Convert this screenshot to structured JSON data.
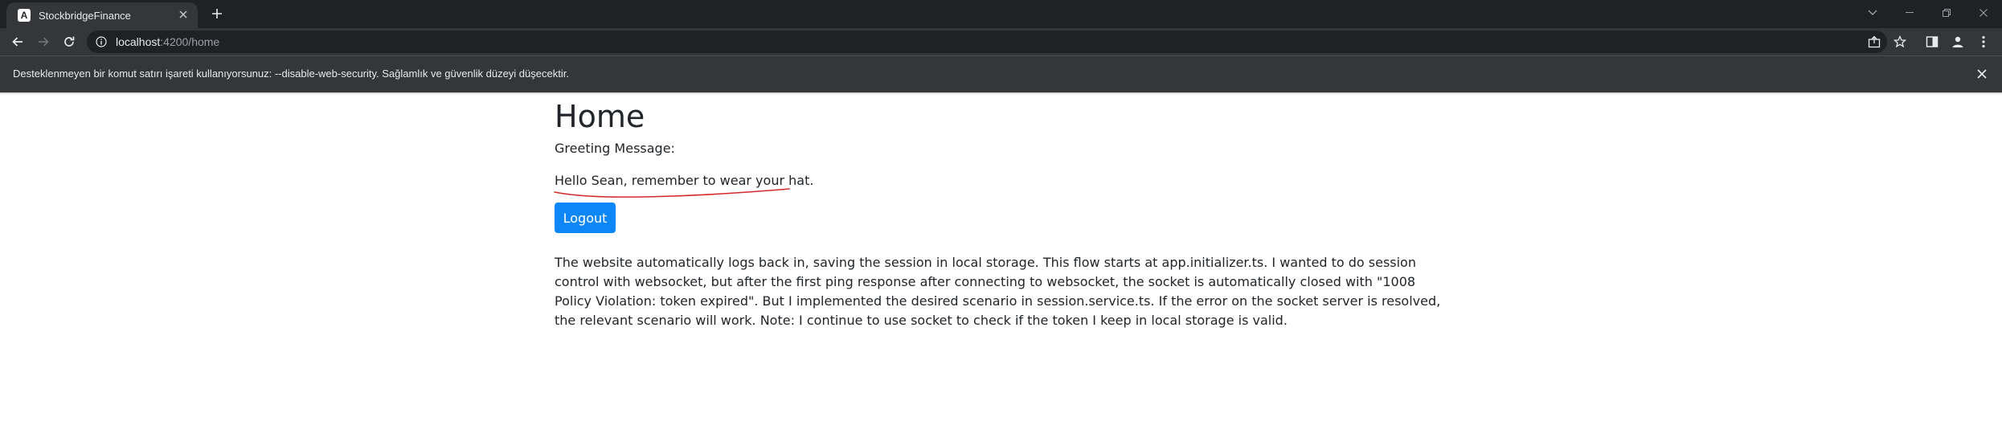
{
  "browser": {
    "tab_title": "StockbridgeFinance",
    "tab_favicon_letter": "A",
    "url_host": "localhost",
    "url_path": ":4200/home",
    "infobar_text": "Desteklenmeyen bir komut satırı işareti kullanıyorsunuz: --disable-web-security. Sağlamlık ve güvenlik düzeyi düşecektir."
  },
  "page": {
    "title": "Home",
    "greeting_label": "Greeting Message:",
    "greeting_message": "Hello Sean, remember to wear your hat.",
    "logout_label": "Logout",
    "description": "The website automatically logs back in, saving the session in local storage. This flow starts at app.initializer.ts. I wanted to do session control with websocket, but after the first ping response after connecting to websocket, the socket is automatically closed with \"1008 Policy Violation: token expired\". But I implemented the desired scenario in session.service.ts. If the error on the socket server is resolved, the relevant scenario will work. Note: I continue to use socket to check if the token I keep in local storage is valid."
  },
  "colors": {
    "titlebar_bg": "#202124",
    "toolbar_bg": "#35363a",
    "button_primary": "#0d86f7",
    "annotation_underline": "#d42a2a"
  },
  "icons": {
    "tab_close": "close-icon",
    "new_tab": "plus-icon",
    "back": "arrow-left-icon",
    "forward": "arrow-right-icon",
    "reload": "reload-icon",
    "site_info": "info-icon",
    "share": "share-icon",
    "bookmark": "star-icon",
    "side_panel": "side-panel-icon",
    "profile": "profile-icon",
    "menu": "kebab-menu-icon",
    "infobar_close": "close-icon"
  }
}
